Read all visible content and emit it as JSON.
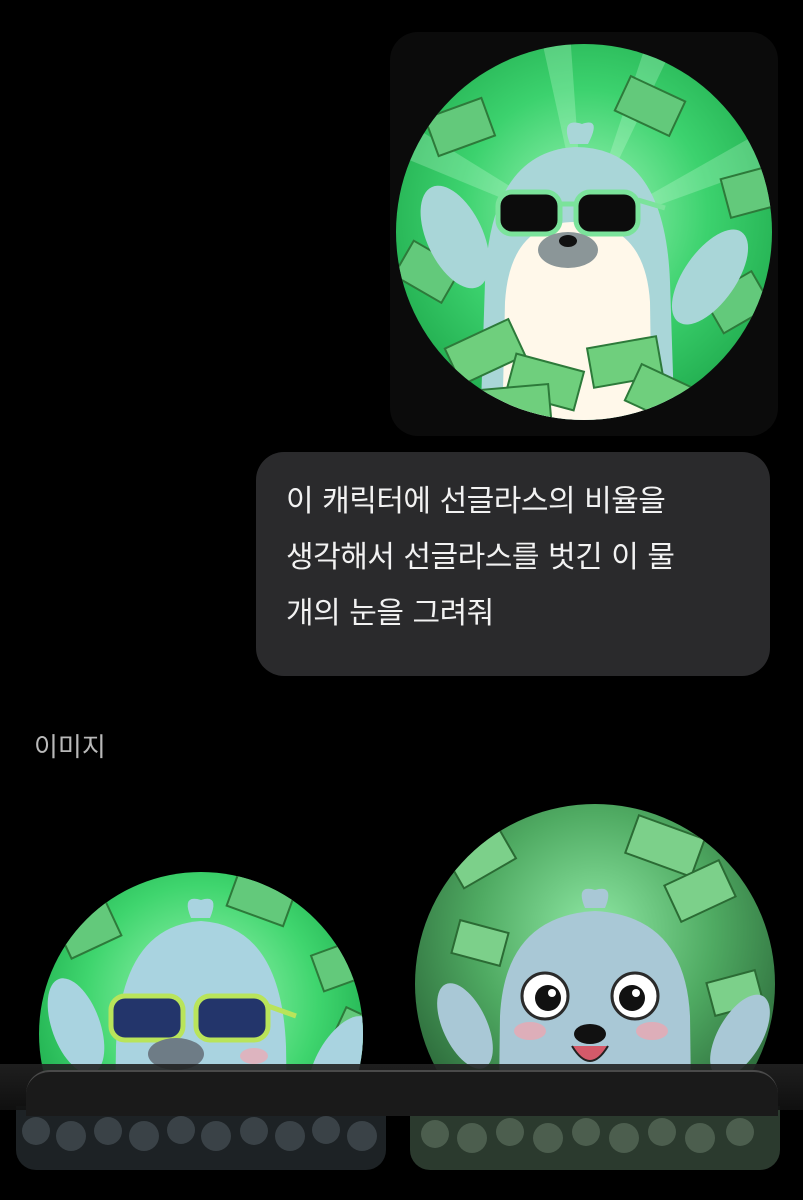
{
  "message": {
    "lines": [
      "이 캐릭터에 선글라스의 비율을",
      "생각해서 선글라스를 벗긴 이 물",
      "개의 눈을 그려줘"
    ]
  },
  "results": {
    "section_label": "이미지"
  },
  "colors": {
    "background": "#000000",
    "bubble": "#2a2a2c",
    "money_green": "#3cd27a",
    "seal_blue": "#a9d6d8"
  }
}
